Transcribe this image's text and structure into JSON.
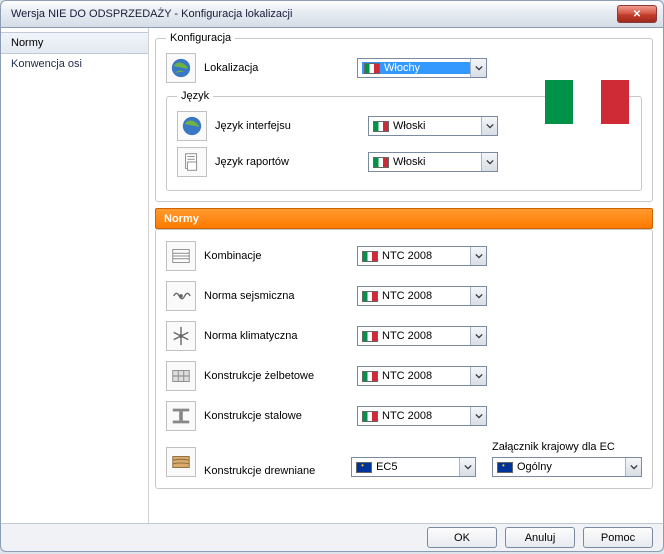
{
  "window": {
    "title": "Wersja NIE DO ODSPRZEDAŻY - Konfiguracja lokalizacji"
  },
  "sidebar": {
    "items": [
      {
        "label": "Normy",
        "active": true
      },
      {
        "label": "Konwencja osi",
        "active": false
      }
    ]
  },
  "config": {
    "legend": "Konfiguracja",
    "localization_label": "Lokalizacja",
    "localization_value": "Włochy",
    "language_legend": "Język",
    "ui_lang_label": "Język interfejsu",
    "ui_lang_value": "Włoski",
    "report_lang_label": "Język raportów",
    "report_lang_value": "Włoski"
  },
  "norms": {
    "header": "Normy",
    "rows": [
      {
        "label": "Kombinacje",
        "value": "NTC 2008",
        "flag": "it",
        "icon": "combinations-icon"
      },
      {
        "label": "Norma sejsmiczna",
        "value": "NTC 2008",
        "flag": "it",
        "icon": "seismic-icon"
      },
      {
        "label": "Norma klimatyczna",
        "value": "NTC 2008",
        "flag": "it",
        "icon": "climate-icon"
      },
      {
        "label": "Konstrukcje żelbetowe",
        "value": "NTC 2008",
        "flag": "it",
        "icon": "concrete-icon"
      },
      {
        "label": "Konstrukcje stalowe",
        "value": "NTC 2008",
        "flag": "it",
        "icon": "steel-icon"
      },
      {
        "label": "Konstrukcje drewniane",
        "value": "EC5",
        "flag": "eu",
        "icon": "timber-icon"
      }
    ],
    "ec_annex_label": "Załącznik krajowy dla EC",
    "ec_annex_value": "Ogólny"
  },
  "buttons": {
    "ok": "OK",
    "cancel": "Anuluj",
    "help": "Pomoc"
  }
}
